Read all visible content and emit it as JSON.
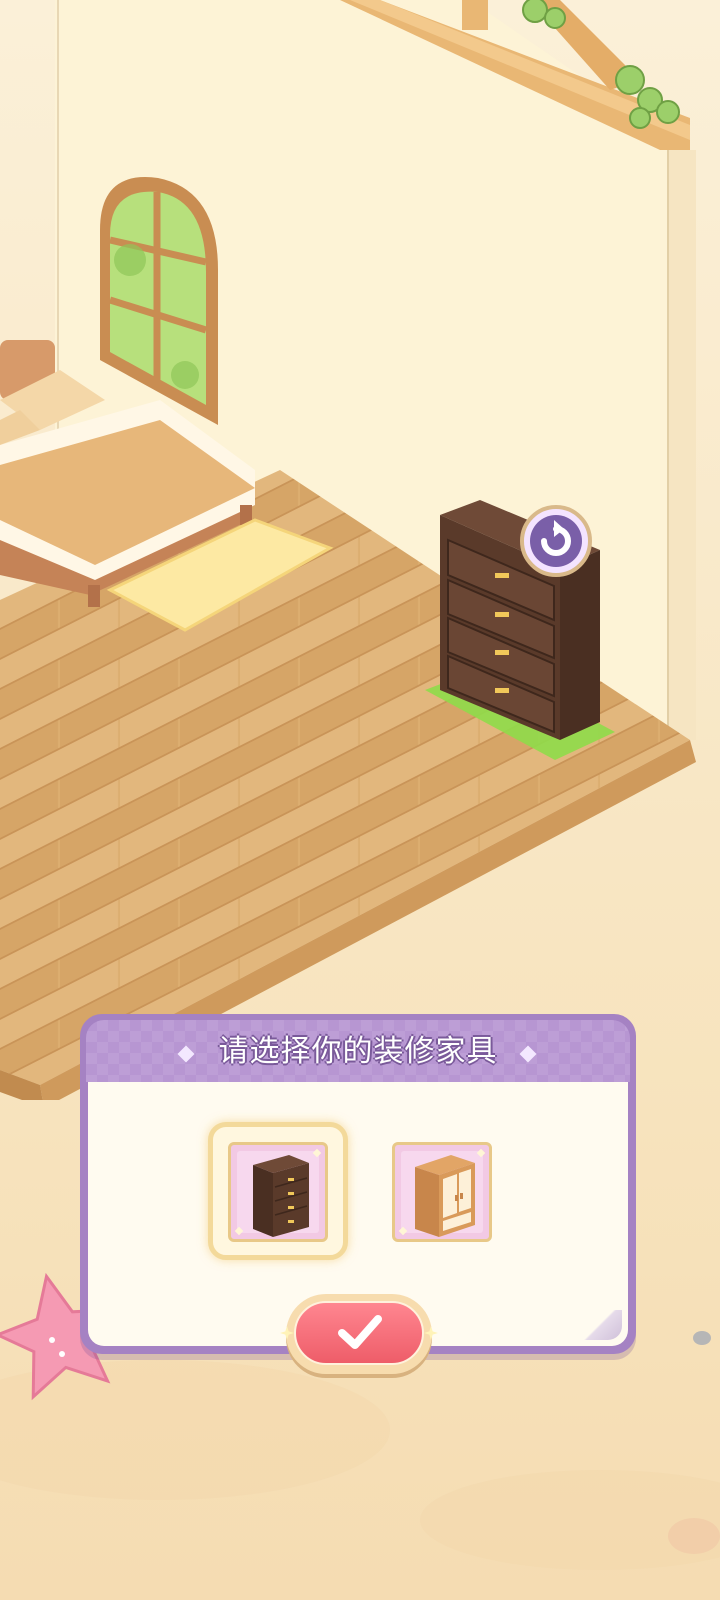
{
  "scene": {
    "description_icons": [
      "window-icon",
      "bed-icon",
      "rug-icon",
      "dresser-icon",
      "rotate-icon",
      "starfish-icon",
      "pebble-icon"
    ]
  },
  "panel": {
    "title": "请选择你的装修家具",
    "options": [
      {
        "name": "dresser-option",
        "icon": "dresser-icon",
        "selected": true
      },
      {
        "name": "wardrobe-option",
        "icon": "wardrobe-icon",
        "selected": false
      }
    ],
    "confirm_icon": "checkmark-icon"
  },
  "colors": {
    "panel_purple": "#a582c3",
    "confirm_red": "#ee5d69",
    "floor_wood": "#d9a96a",
    "wall_cream": "#fdf3d6",
    "placement_green": "#8fdc4a"
  }
}
